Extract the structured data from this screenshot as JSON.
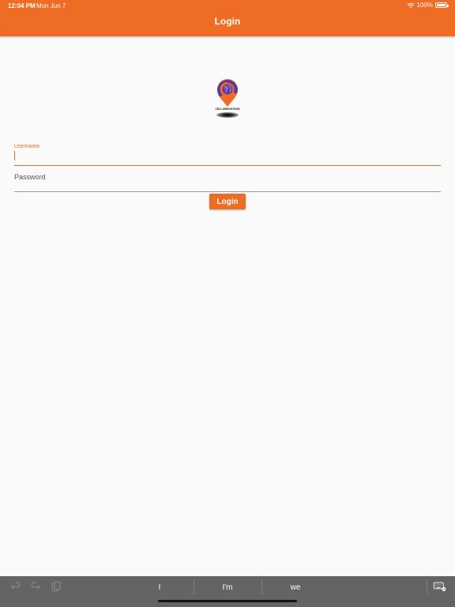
{
  "status_bar": {
    "time": "12:04 PM",
    "date": "Mon Jun 7",
    "battery": "100%"
  },
  "header": {
    "title": "Login"
  },
  "logo": {
    "text": "CELLARMOSTAGS"
  },
  "form": {
    "username_label": "Username",
    "username_value": "",
    "password_label": "Password",
    "login_button": "Login"
  },
  "keyboard": {
    "suggestions": [
      "I",
      "I'm",
      "we"
    ],
    "icons": [
      "undo-icon",
      "redo-icon",
      "paste-icon",
      "keyboard-hide-icon"
    ]
  },
  "colors": {
    "accent": "#ef6c24",
    "background": "#fafafa",
    "keyboard_bar": "#646464"
  }
}
